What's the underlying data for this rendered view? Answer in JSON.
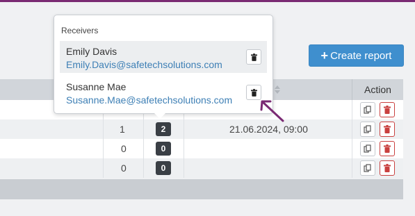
{
  "colors": {
    "accent": "#3f8fce",
    "top_bar": "#7a2a73",
    "delete": "#c9403f",
    "badge": "#3a3f45",
    "link": "#3d7fb5",
    "annotation_arrow": "#7a2a73"
  },
  "toolbar": {
    "create_label": "Create report",
    "create_icon": "plus-icon"
  },
  "table": {
    "action_header": "Action",
    "rows": [
      {
        "count": "",
        "badge": "",
        "date": ""
      },
      {
        "count": "1",
        "badge": "2",
        "date": "21.06.2024, 09:00"
      },
      {
        "count": "0",
        "badge": "0",
        "date": ""
      },
      {
        "count": "0",
        "badge": "0",
        "date": ""
      }
    ],
    "icons": {
      "copy": "copy-icon",
      "delete": "trash-icon",
      "sort": "sort-icon"
    }
  },
  "popover": {
    "title": "Receivers",
    "receivers": [
      {
        "name": "Emily Davis",
        "email": "Emily.Davis@safetechsolutions.com"
      },
      {
        "name": "Susanne Mae",
        "email": "Susanne.Mae@safetechsolutions.com"
      }
    ]
  }
}
